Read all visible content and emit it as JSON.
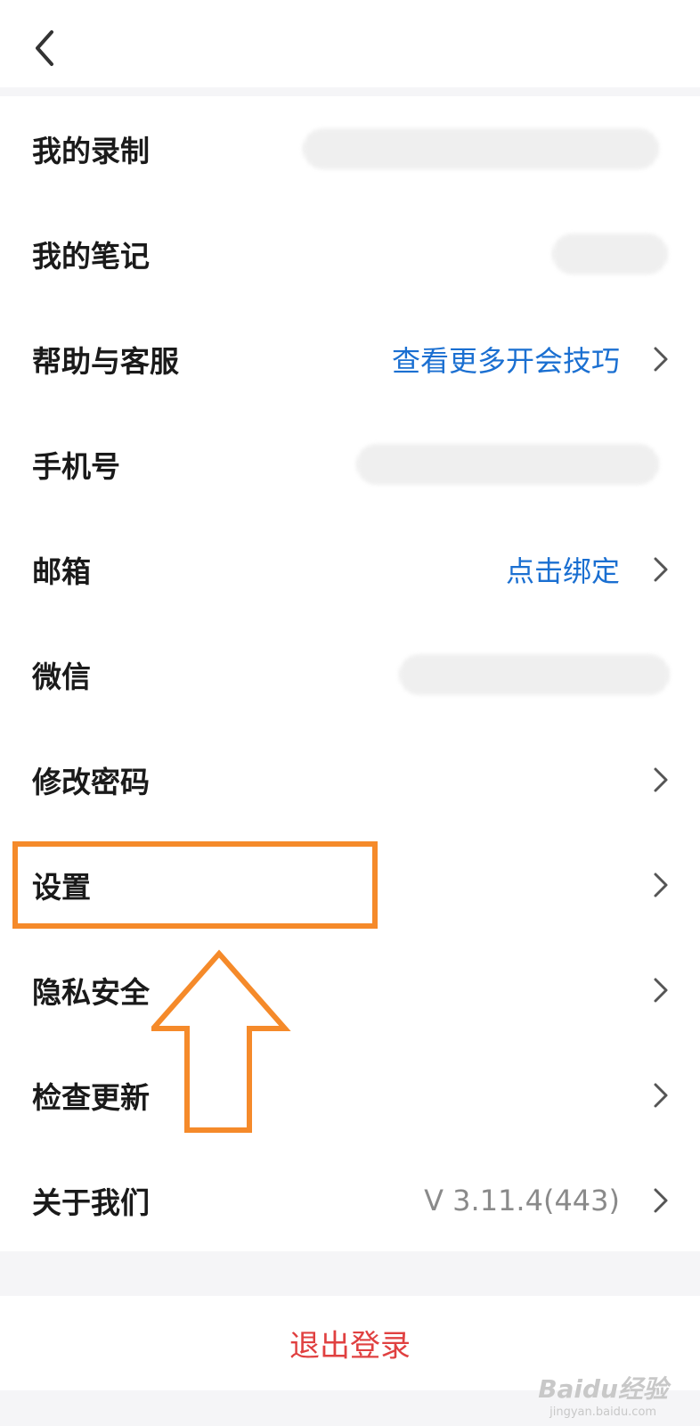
{
  "header": {
    "back_icon": "chevron-left-icon"
  },
  "menu": {
    "items": [
      {
        "label": "我的录制",
        "value": null,
        "value_style": "redacted",
        "chevron": false
      },
      {
        "label": "我的笔记",
        "value": null,
        "value_style": "redacted",
        "chevron": false
      },
      {
        "label": "帮助与客服",
        "value": "查看更多开会技巧",
        "value_style": "link",
        "chevron": true
      },
      {
        "label": "手机号",
        "value": null,
        "value_style": "redacted",
        "chevron": false
      },
      {
        "label": "邮箱",
        "value": "点击绑定",
        "value_style": "link",
        "chevron": true
      },
      {
        "label": "微信",
        "value": null,
        "value_style": "redacted",
        "chevron": false
      },
      {
        "label": "修改密码",
        "value": null,
        "value_style": "none",
        "chevron": true
      },
      {
        "label": "设置",
        "value": null,
        "value_style": "none",
        "chevron": true,
        "highlighted": true
      },
      {
        "label": "隐私安全",
        "value": null,
        "value_style": "none",
        "chevron": true
      },
      {
        "label": "检查更新",
        "value": null,
        "value_style": "none",
        "chevron": true
      },
      {
        "label": "关于我们",
        "value": "V 3.11.4(443)",
        "value_style": "muted",
        "chevron": true
      }
    ]
  },
  "footer": {
    "logout_label": "退出登录"
  },
  "watermark": {
    "main": "Baidu经验",
    "sub": "jingyan.baidu.com"
  },
  "colors": {
    "link": "#1a6fd1",
    "danger": "#e04040",
    "annotation": "#f58a2a",
    "background": "#f5f5f7"
  }
}
